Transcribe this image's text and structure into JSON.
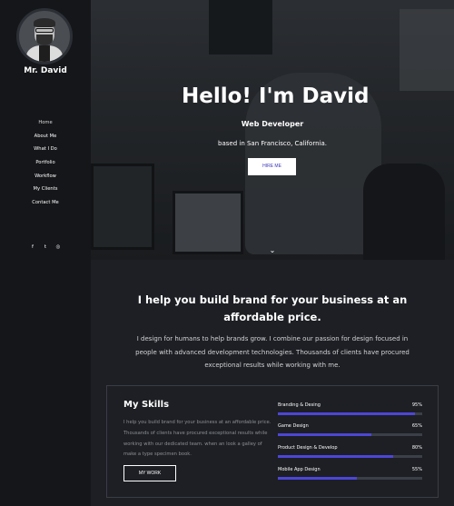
{
  "profile": {
    "name": "Mr. David"
  },
  "nav": [
    "Home",
    "About Me",
    "What I Do",
    "Portfolio",
    "Workflow",
    "My Clients",
    "Contact Me"
  ],
  "social": [
    "facebook-icon",
    "twitter-icon",
    "dribbble-icon"
  ],
  "social_glyphs": [
    "f",
    "t",
    "◎"
  ],
  "hero": {
    "title": "Hello! I'm David",
    "role": "Web Developer",
    "location": "based in San Francisco, California.",
    "cta": "HIRE ME",
    "scroll_icon": "⌄"
  },
  "about": {
    "heading": "I help you build brand for your business at an affordable price.",
    "text": "I design for humans to help brands grow. I combine our passion for design focused in people with advanced development technologies. Thousands of clients have procured exceptional results while working with me."
  },
  "skills": {
    "title": "My Skills",
    "text": "I help you build brand for your business at an affordable price. Thousands of clients have procured exceptional results while working with our dedicated team. when an look a galley of make a type specimen book.",
    "button": "MY WORK",
    "items": [
      {
        "label": "Branding & Desing",
        "percent": 95,
        "percent_label": "95%"
      },
      {
        "label": "Game Design",
        "percent": 65,
        "percent_label": "65%"
      },
      {
        "label": "Product Design & Develop",
        "percent": 80,
        "percent_label": "80%"
      },
      {
        "label": "Mobile App Design",
        "percent": 55,
        "percent_label": "55%"
      }
    ]
  },
  "colors": {
    "accent": "#4d46d6",
    "sidebar": "#141619",
    "background": "#1d1f24"
  }
}
